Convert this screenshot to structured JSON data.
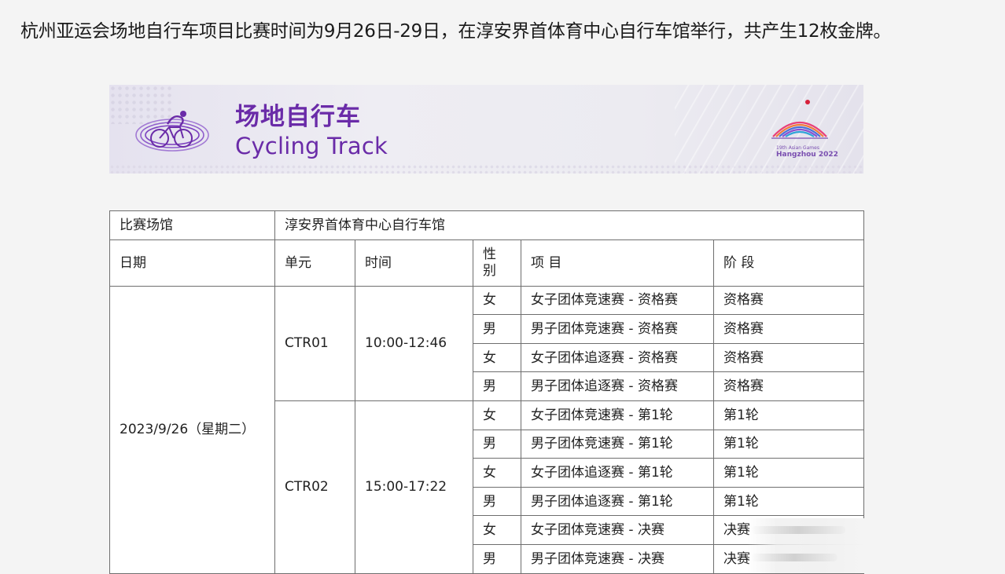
{
  "intro": {
    "text": "杭州亚运会场地自行车项目比赛时间为9月26日-29日，在淳安界首体育中心自行车馆举行，共产生12枚金牌。"
  },
  "banner": {
    "title_cn": "场地自行车",
    "title_en": "Cycling Track",
    "logo_line1": "19th Asian Games",
    "logo_line2": "Hangzhou 2022",
    "colors": {
      "title": "#6a2ba8",
      "background": "#eceaf2"
    },
    "icons": [
      "cyclist-icon",
      "hangzhou-asian-games-logo"
    ]
  },
  "schedule": {
    "venue_label": "比赛场馆",
    "venue_value": "淳安界首体育中心自行车馆",
    "headers": {
      "date": "日期",
      "unit": "单元",
      "time": "时间",
      "gender": "性别",
      "event": "项 目",
      "stage": "阶 段"
    },
    "date": "2023/9/26（星期二）",
    "units": [
      {
        "code": "CTR01",
        "time": "10:00-12:46",
        "rows": [
          {
            "gender": "女",
            "event": "女子团体竞速赛 - 资格赛",
            "stage": "资格赛"
          },
          {
            "gender": "男",
            "event": "男子团体竞速赛 - 资格赛",
            "stage": "资格赛"
          },
          {
            "gender": "女",
            "event": "女子团体追逐赛 - 资格赛",
            "stage": "资格赛"
          },
          {
            "gender": "男",
            "event": "男子团体追逐赛 - 资格赛",
            "stage": "资格赛"
          }
        ]
      },
      {
        "code": "CTR02",
        "time": "15:00-17:22",
        "rows": [
          {
            "gender": "女",
            "event": "女子团体竞速赛 - 第1轮",
            "stage": "第1轮"
          },
          {
            "gender": "男",
            "event": "男子团体竞速赛 - 第1轮",
            "stage": "第1轮"
          },
          {
            "gender": "女",
            "event": "女子团体追逐赛 - 第1轮",
            "stage": "第1轮"
          },
          {
            "gender": "男",
            "event": "男子团体追逐赛 - 第1轮",
            "stage": "第1轮"
          },
          {
            "gender": "女",
            "event": "女子团体竞速赛 - 决赛",
            "stage": "决赛"
          },
          {
            "gender": "男",
            "event": "男子团体竞速赛 - 决赛",
            "stage": "决赛"
          }
        ]
      }
    ]
  }
}
